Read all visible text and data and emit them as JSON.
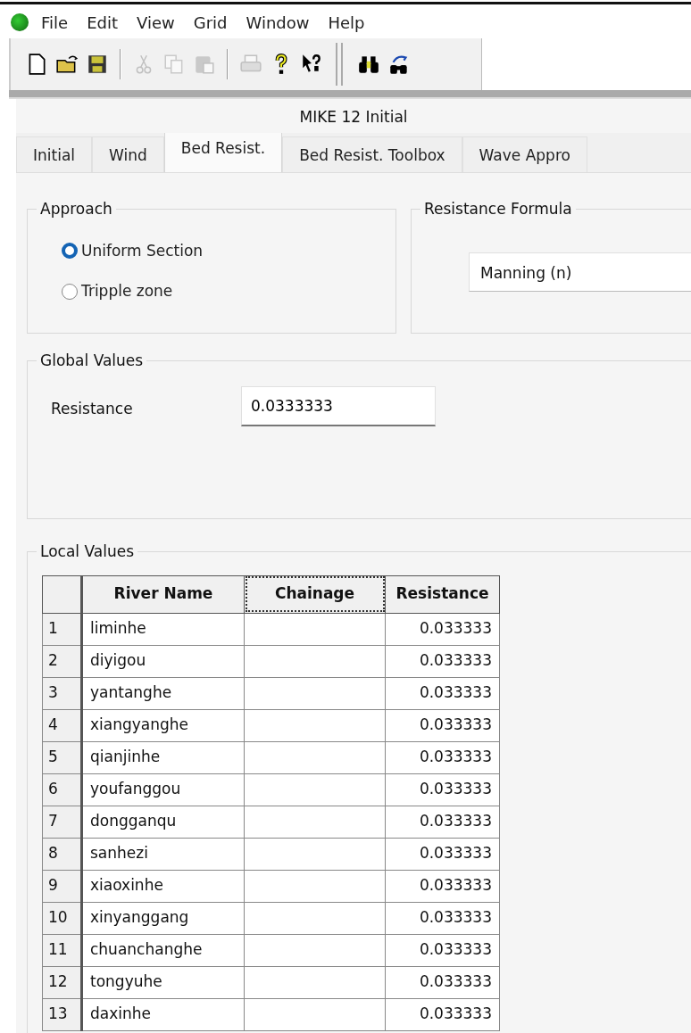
{
  "menu": [
    "File",
    "Edit",
    "View",
    "Grid",
    "Window",
    "Help"
  ],
  "toolbar": [
    {
      "kind": "new",
      "disabled": false
    },
    {
      "kind": "open",
      "disabled": false
    },
    {
      "kind": "save",
      "disabled": false
    },
    {
      "kind": "separator"
    },
    {
      "kind": "cut",
      "disabled": true
    },
    {
      "kind": "copy",
      "disabled": true
    },
    {
      "kind": "paste",
      "disabled": true
    },
    {
      "kind": "separator"
    },
    {
      "kind": "print",
      "disabled": true
    },
    {
      "kind": "help",
      "disabled": false
    },
    {
      "kind": "context-help",
      "disabled": false
    },
    {
      "kind": "grip"
    },
    {
      "kind": "find",
      "disabled": false
    },
    {
      "kind": "find-next",
      "disabled": false
    }
  ],
  "window": {
    "title": "MIKE 12 Initial"
  },
  "tabs": [
    {
      "label": "Initial",
      "selected": false
    },
    {
      "label": "Wind",
      "selected": false
    },
    {
      "label": "Bed Resist.",
      "selected": true
    },
    {
      "label": "Bed Resist. Toolbox",
      "selected": false
    },
    {
      "label": "Wave Appro",
      "selected": false
    }
  ],
  "approach": {
    "title": "Approach",
    "options": [
      {
        "label": "Uniform Section",
        "selected": true
      },
      {
        "label": "Tripple zone",
        "selected": false
      }
    ]
  },
  "resistance_formula": {
    "title": "Resistance Formula",
    "value": "Manning (n)"
  },
  "global_values": {
    "title": "Global Values",
    "label": "Resistance",
    "value": "0.0333333"
  },
  "local_values": {
    "title": "Local Values",
    "columns": [
      {
        "label": "River Name",
        "focused": false
      },
      {
        "label": "Chainage",
        "focused": true
      },
      {
        "label": "Resistance",
        "focused": false
      }
    ],
    "rows": [
      {
        "number": "1",
        "river_name": "liminhe",
        "resistance": "0.033333"
      },
      {
        "number": "2",
        "river_name": "diyigou",
        "resistance": "0.033333"
      },
      {
        "number": "3",
        "river_name": "yantanghe",
        "resistance": "0.033333"
      },
      {
        "number": "4",
        "river_name": "xiangyanghe",
        "resistance": "0.033333"
      },
      {
        "number": "5",
        "river_name": "qianjinhe",
        "resistance": "0.033333"
      },
      {
        "number": "6",
        "river_name": "youfanggou",
        "resistance": "0.033333"
      },
      {
        "number": "7",
        "river_name": "dongganqu",
        "resistance": "0.033333"
      },
      {
        "number": "8",
        "river_name": "sanhezi",
        "resistance": "0.033333"
      },
      {
        "number": "9",
        "river_name": "xiaoxinhe",
        "resistance": "0.033333"
      },
      {
        "number": "10",
        "river_name": "xinyanggang",
        "resistance": "0.033333"
      },
      {
        "number": "11",
        "river_name": "chuanchanghe",
        "resistance": "0.033333"
      },
      {
        "number": "12",
        "river_name": "tongyuhe",
        "resistance": "0.033333"
      },
      {
        "number": "13",
        "river_name": "daxinhe",
        "resistance": "0.033333"
      }
    ]
  }
}
